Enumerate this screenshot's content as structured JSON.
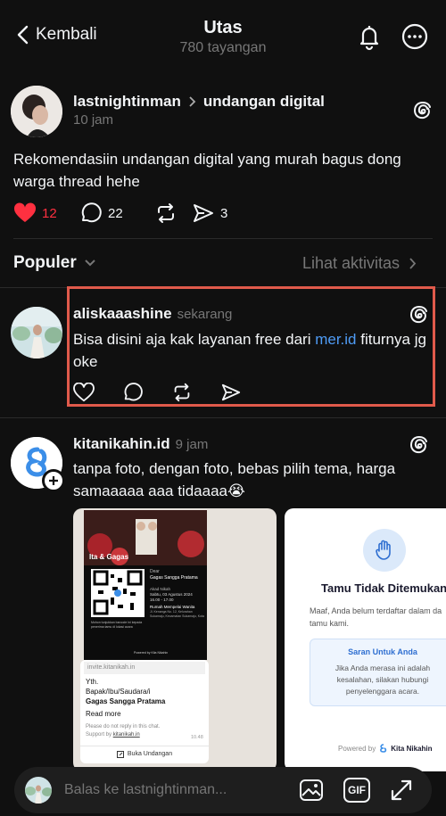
{
  "header": {
    "back_label": "Kembali",
    "title": "Utas",
    "views": "780 tayangan"
  },
  "main_post": {
    "author": "lastnightinman",
    "topic": "undangan digital",
    "time": "10 jam",
    "text": "Rekomendasiin undangan digital yang murah bagus dong warga thread hehe",
    "likes": "12",
    "comments": "22",
    "shares": "3"
  },
  "sort": {
    "label": "Populer",
    "activity_link": "Lihat aktivitas"
  },
  "reply1": {
    "author": "aliskaaashine",
    "time": "sekarang",
    "text_before": "Bisa disini aja kak layanan free dari ",
    "link": "mer.id",
    "text_after": " fiturnya jg oke"
  },
  "reply2": {
    "author": "kitanikahin.id",
    "time": "9 jam",
    "text": "tanpa foto, dengan foto, bebas pilih tema, harga samaaaaa aaa tidaaaa😭"
  },
  "card1": {
    "couple": "Ita & Gagas",
    "dear": "Dear",
    "guest": "Gagas Sangga Pratama",
    "event": "Akad Nikah",
    "date": "Sabtu, 03 Agustus 2024",
    "time": "16.00 - 17.00",
    "venue": "Rumah Mempelai Wanita",
    "venue_addr": "Jl. Kenanga No. 12, Kelurahan Sukamaju, Kecamatan Sukamaju, Kota Bandung",
    "note": "Mohon tunjukkan barcode ini kepada penerima tamu di lokasi acara",
    "powered": "Powered by Kita Nikahin",
    "link_url": "invite.kitanikah.in",
    "yth": "Yth.",
    "salutation": "Bapak/Ibu/Saudara/i",
    "recipient": "Gagas Sangga Pratama",
    "read_more": "Read more",
    "no_reply": "Please do not reply in this chat.",
    "support_prefix": "Support by ",
    "support_link": "kitanikah.in",
    "msg_time": "10.48",
    "open_button": "Buka Undangan"
  },
  "card2": {
    "title": "Tamu Tidak Ditemukan",
    "body": "Maaf, Anda belum terdaftar dalam da tamu kami.",
    "suggest_title": "Saran Untuk Anda",
    "suggest_body": "Jika Anda merasa ini adalah kesalahan, silakan hubungi penyelenggara acara.",
    "powered_prefix": "Powered by",
    "brand": "Kita Nikahin"
  },
  "reply_bar": {
    "placeholder": "Balas ke lastnightinman...",
    "gif_label": "GIF"
  },
  "colors": {
    "background": "#101010",
    "like_red": "#ff3040",
    "link_blue": "#4f9cf6",
    "highlight_border": "#e05a4b"
  }
}
